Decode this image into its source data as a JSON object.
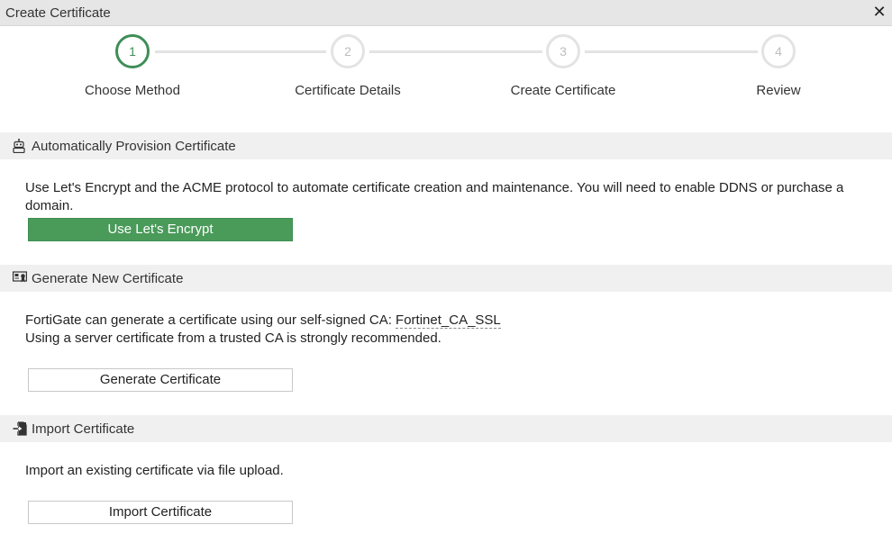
{
  "dialog": {
    "title": "Create Certificate",
    "close_label": "✕"
  },
  "stepper": {
    "steps": [
      {
        "number": "1",
        "label": "Choose Method",
        "active": true
      },
      {
        "number": "2",
        "label": "Certificate Details",
        "active": false
      },
      {
        "number": "3",
        "label": "Create Certificate",
        "active": false
      },
      {
        "number": "4",
        "label": "Review",
        "active": false
      }
    ]
  },
  "sections": {
    "auto": {
      "icon": "robot-icon",
      "title": "Automatically Provision Certificate",
      "description": "Use Let's Encrypt and the ACME protocol to automate certificate creation and maintenance. You will need to enable DDNS or purchase a domain.",
      "button_label": "Use Let's Encrypt"
    },
    "generate": {
      "icon": "certificate-card-icon",
      "title": "Generate New Certificate",
      "description_line1_prefix": "FortiGate can generate a certificate using our self-signed CA: ",
      "ca_name": "Fortinet_CA_SSL",
      "description_line2": "Using a server certificate from a trusted CA is strongly recommended.",
      "button_label": "Generate Certificate"
    },
    "import": {
      "icon": "import-file-icon",
      "title": "Import Certificate",
      "description": "Import an existing certificate via file upload.",
      "button_label": "Import Certificate"
    }
  },
  "colors": {
    "accent_green": "#3e8e57",
    "primary_button": "#4a9a5a",
    "section_header_bg": "#f0f0f0",
    "titlebar_bg": "#e6e6e6"
  }
}
